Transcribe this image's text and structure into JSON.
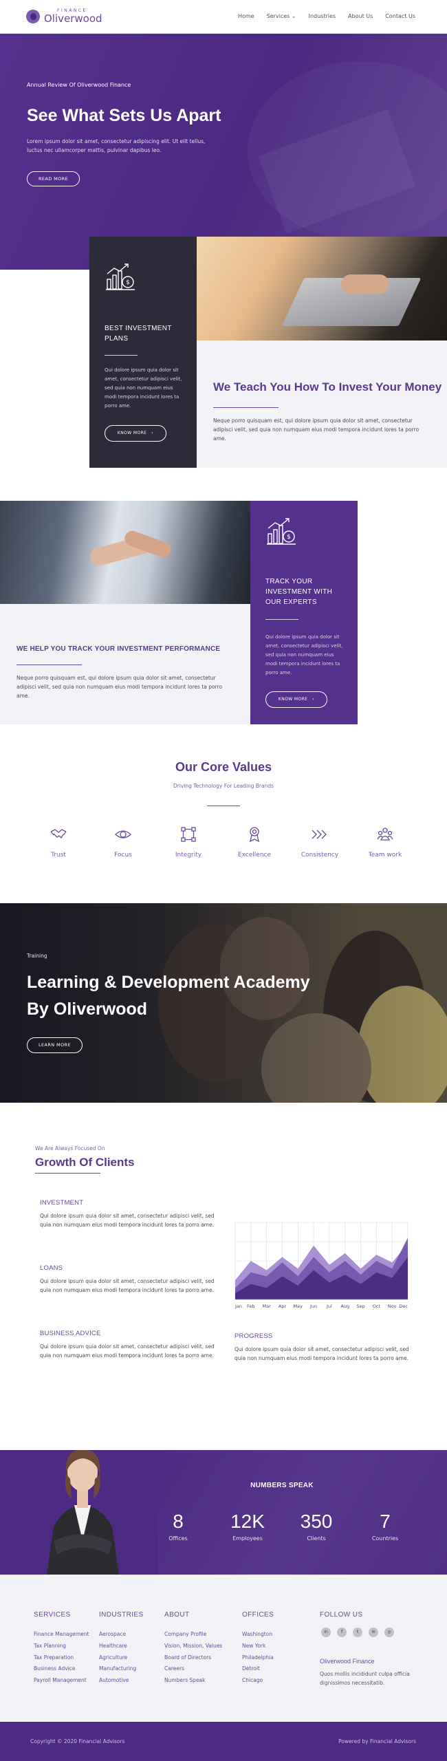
{
  "brand": {
    "small": "FINANCE",
    "name": "Oliverwood",
    "accent": "#4c2a83"
  },
  "nav": {
    "items": [
      {
        "label": "Home"
      },
      {
        "label": "Services",
        "icon": "chevron-down-icon"
      },
      {
        "label": "Industries"
      },
      {
        "label": "About Us"
      },
      {
        "label": "Contact Us"
      }
    ]
  },
  "hero": {
    "eyebrow": "Annual Review Of Oliverwood Finance",
    "title": "See What Sets Us Apart",
    "text": "Lorem ipsum dolor sit amet, consectetur adipiscing elit. Ut elit tellus, luctus nec ullamcorper mattis, pulvinar dapibus leo.",
    "button": "READ MORE"
  },
  "feature1": {
    "card_title": "BEST INVESTMENT PLANS",
    "card_text": "Qui dolore ipsum quia dolor sit amet, consectetur adipisci velit, sed quia non numquam eius modi tempora incidunt lores ta porro ame.",
    "card_button": "KNOW MORE",
    "card_button_icon": "chevron-right-icon",
    "heading": "We Teach You How To Invest Your Money",
    "paragraph": "Neque porro quisquam est, qui dolore ipsum quia dolor sit amet, consectetur adipisci velit, sed quia non numquam eius modi tempora incidunt lores ta porro ame."
  },
  "feature2": {
    "card_title": "TRACK YOUR INVESTMENT WITH OUR EXPERTS",
    "card_text": "Qui dolore ipsum quia dolor sit amet, consectetur adipisci velit, sed quia non numquam eius modi tempora incidunt lores ta porro ame.",
    "card_button": "KNOW MORE",
    "card_button_icon": "chevron-right-icon",
    "heading": "WE HELP YOU TRACK YOUR INVESTMENT PERFORMANCE",
    "paragraph": "Neque porro quisquam est, qui dolore ipsum quia dolor sit amet, consectetur adipisci velit, sed quia non numquam eius modi tempora incidunt lores ta porro ame."
  },
  "core_values": {
    "title": "Our Core Values",
    "subtitle": "Driving Technology For Leading Brands",
    "items": [
      {
        "label": "Trust",
        "icon": "handshake-icon"
      },
      {
        "label": "Focus",
        "icon": "eye-icon"
      },
      {
        "label": "Integrity",
        "icon": "network-icon"
      },
      {
        "label": "Excellence",
        "icon": "award-icon"
      },
      {
        "label": "Consistency",
        "icon": "chevrons-right-icon"
      },
      {
        "label": "Team work",
        "icon": "team-icon"
      }
    ]
  },
  "academy": {
    "eyebrow": "Training",
    "title": "Learning & Development Academy By Oliverwood",
    "button": "LEARN MORE"
  },
  "growth": {
    "eyebrow": "We Are Always Focused On",
    "title": "Growth Of Clients",
    "blocks": [
      {
        "label": "INVESTMENT",
        "text": "Qui dolore ipsum quia dolor sit amet, consectetur adipisci velit, sed quia non numquam eius modi tempora incidunt lores ta porro ame."
      },
      {
        "label": "LOANS",
        "text": "Qui dolore ipsum quia dolor sit amet, consectetur adipisci velit, sed quia non numquam eius modi tempora incidunt lores ta porro ame."
      },
      {
        "label": "BUSINESS ADVICE",
        "text": "Qui dolore ipsum quia dolor sit amet, consectetur adipisci velit, sed quia non numquam eius modi tempora incidunt lores ta porro ame."
      },
      {
        "label": "PROGRESS",
        "text": "Qui dolore ipsum quia dolor sit amet, consectetur adipisci velit, sed quia non numquam eius modi tempora incidunt lores ta porro ame."
      }
    ]
  },
  "chart_data": {
    "type": "area",
    "title": "",
    "xlabel": "",
    "ylabel": "",
    "categories": [
      "Jan",
      "Feb",
      "Mar",
      "Apr",
      "May",
      "Jun",
      "Jul",
      "Aug",
      "Sep",
      "Oct",
      "Nov",
      "Dec"
    ],
    "ylim": [
      0,
      100
    ],
    "grid": true,
    "legend": "none",
    "series": [
      {
        "values": [
          25,
          50,
          38,
          55,
          40,
          70,
          45,
          60,
          40,
          58,
          48,
          72
        ],
        "color": "#a58bd0"
      },
      {
        "values": [
          15,
          35,
          30,
          48,
          30,
          55,
          35,
          50,
          32,
          50,
          40,
          80
        ],
        "color": "#7456ae"
      },
      {
        "values": [
          8,
          20,
          15,
          30,
          18,
          38,
          22,
          32,
          20,
          35,
          28,
          55
        ],
        "color": "#4b2b82"
      }
    ]
  },
  "numbers": {
    "title": "NUMBERS SPEAK",
    "items": [
      {
        "value": "8",
        "label": "Offices"
      },
      {
        "value": "12K",
        "label": "Employees"
      },
      {
        "value": "350",
        "label": "Clients"
      },
      {
        "value": "7",
        "label": "Countries"
      }
    ]
  },
  "footer": {
    "columns": [
      {
        "title": "SERVICES",
        "items": [
          "Finance Management",
          "Tax Planning",
          "Tax Preparation",
          "Business Advice",
          "Payroll Management"
        ]
      },
      {
        "title": "INDUSTRIES",
        "items": [
          "Aerospace",
          "Healthcare",
          "Agriculture",
          "Manufacturing",
          "Automotive"
        ]
      },
      {
        "title": "ABOUT",
        "items": [
          "Company Profile",
          "Vision, Mission, Values",
          "Board of Directors",
          "Careers",
          "Numbers Speak"
        ]
      },
      {
        "title": "OFFICES",
        "items": [
          "Washington",
          "New York",
          "Philadelphia",
          "Detroit",
          "Chicago"
        ]
      }
    ],
    "follow": {
      "title": "FOLLOW US",
      "icons": [
        {
          "name": "linkedin-icon",
          "glyph": "in"
        },
        {
          "name": "facebook-icon",
          "glyph": "f"
        },
        {
          "name": "twitter-icon",
          "glyph": "t"
        },
        {
          "name": "email-icon",
          "glyph": "✉"
        },
        {
          "name": "instagram-icon",
          "glyph": "◎"
        }
      ],
      "name": "Oliverwood Finance",
      "text": "Quos mollis incididunt culpa officia dignissimos necessitatib."
    },
    "copyright": "Copyright © 2020 Financial Advisors",
    "powered": "Powered by Financial Advisors"
  }
}
